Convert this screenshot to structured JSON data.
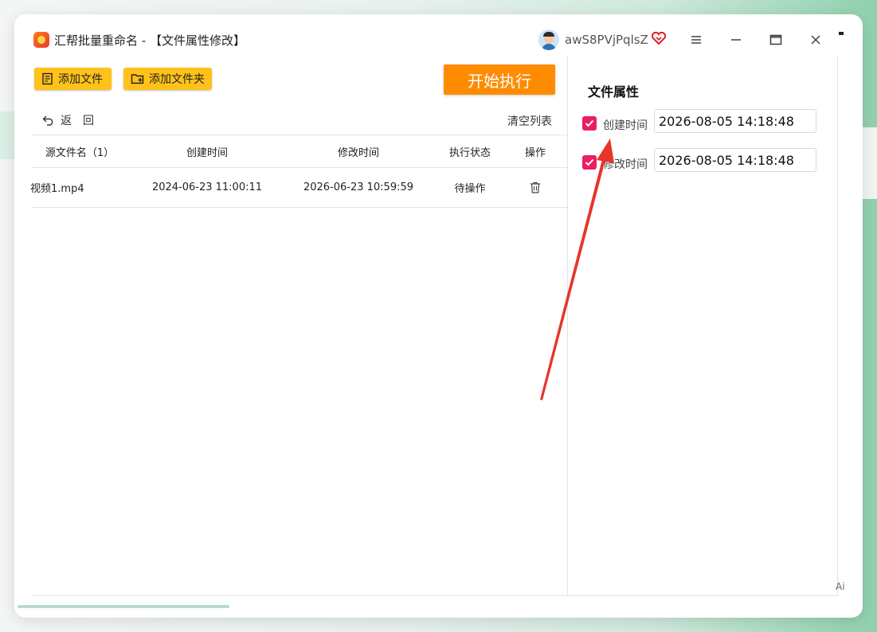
{
  "titlebar": {
    "title": "汇帮批量重命名 - 【文件属性修改】",
    "username": "awS8PVjPqlsZ",
    "icons": [
      "app-icon",
      "avatar",
      "vip-heart-icon",
      "menu-icon",
      "minimize-icon",
      "maximize-icon",
      "close-icon"
    ]
  },
  "toolbar": {
    "add_file_label": "添加文件",
    "add_folder_label": "添加文件夹",
    "start_label": "开始执行"
  },
  "nav": {
    "back_label": "返　回",
    "clear_label": "清空列表"
  },
  "table": {
    "headers": [
      "源文件名（1）",
      "创建时间",
      "修改时间",
      "执行状态",
      "操作"
    ],
    "rows": [
      {
        "name": "视频1.mp4",
        "created": "2024-06-23 11:00:11",
        "modified": "2026-06-23 10:59:59",
        "status": "待操作"
      }
    ]
  },
  "properties": {
    "title": "文件属性",
    "create_label": "创建时间",
    "create_value": "2026-08-05 14:18:48",
    "create_checked": true,
    "modify_label": "修改时间",
    "modify_value": "2026-08-05 14:18:48",
    "modify_checked": true
  },
  "misc": {
    "ai_mark": "Ai"
  },
  "colors": {
    "start_button": "#ff8c00",
    "yellow_button": "#ffc21a",
    "checkbox": "#e91e63",
    "annotation_arrow": "#e8342b"
  }
}
